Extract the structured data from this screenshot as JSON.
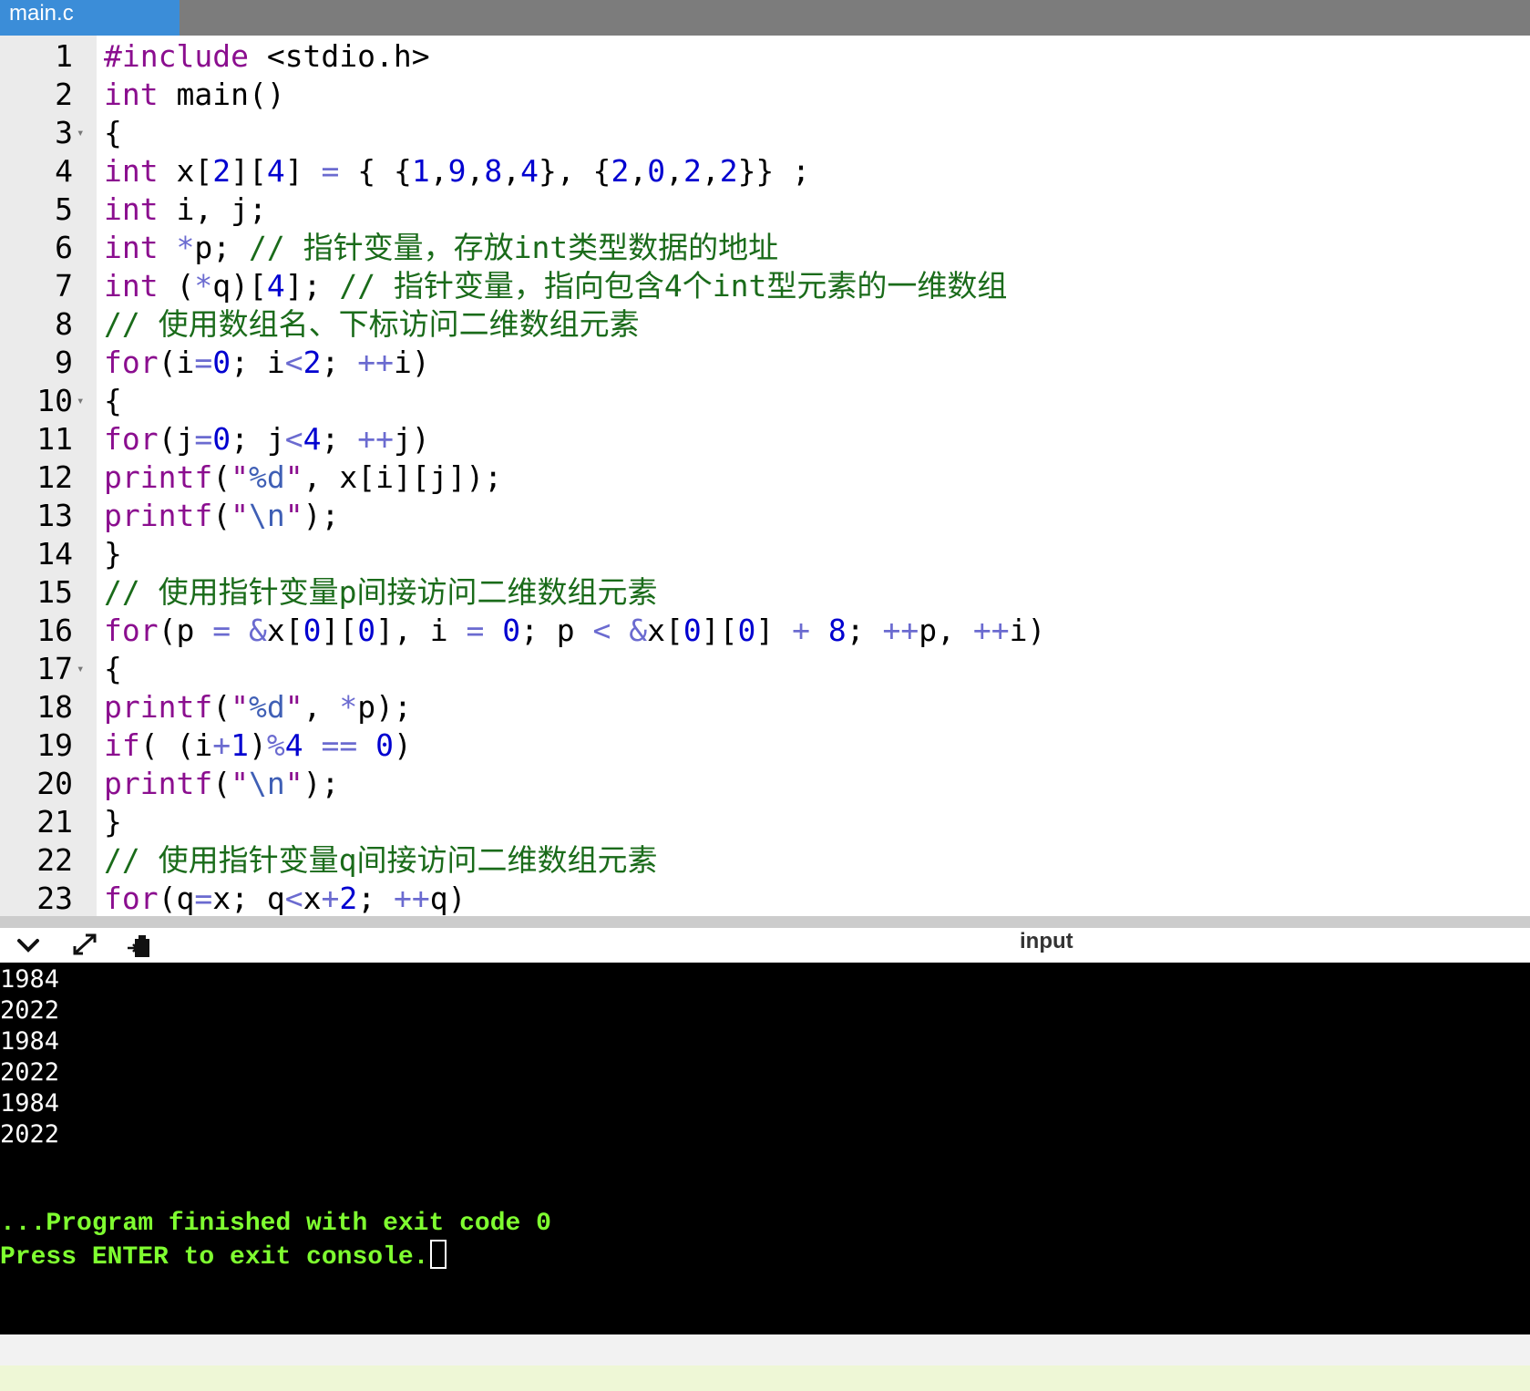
{
  "tab": {
    "filename": "main.c"
  },
  "editor": {
    "lines": [
      {
        "n": "1",
        "fold": "",
        "tokens": [
          [
            "pp",
            "#include"
          ],
          [
            "txt",
            " <stdio.h>"
          ]
        ]
      },
      {
        "n": "2",
        "fold": "",
        "tokens": [
          [
            "kw",
            "int"
          ],
          [
            "txt",
            " main()"
          ]
        ]
      },
      {
        "n": "3",
        "fold": "▾",
        "tokens": [
          [
            "txt",
            "{"
          ]
        ]
      },
      {
        "n": "4",
        "fold": "",
        "tokens": [
          [
            "kw",
            "int"
          ],
          [
            "txt",
            " x["
          ],
          [
            "num",
            "2"
          ],
          [
            "txt",
            "]["
          ],
          [
            "num",
            "4"
          ],
          [
            "txt",
            "] "
          ],
          [
            "op",
            "="
          ],
          [
            "txt",
            " { {"
          ],
          [
            "num",
            "1"
          ],
          [
            "txt",
            ","
          ],
          [
            "num",
            "9"
          ],
          [
            "txt",
            ","
          ],
          [
            "num",
            "8"
          ],
          [
            "txt",
            ","
          ],
          [
            "num",
            "4"
          ],
          [
            "txt",
            "}, {"
          ],
          [
            "num",
            "2"
          ],
          [
            "txt",
            ","
          ],
          [
            "num",
            "0"
          ],
          [
            "txt",
            ","
          ],
          [
            "num",
            "2"
          ],
          [
            "txt",
            ","
          ],
          [
            "num",
            "2"
          ],
          [
            "txt",
            "}} ;"
          ]
        ]
      },
      {
        "n": "5",
        "fold": "",
        "tokens": [
          [
            "kw",
            "int"
          ],
          [
            "txt",
            " i, j;"
          ]
        ]
      },
      {
        "n": "6",
        "fold": "",
        "tokens": [
          [
            "kw",
            "int"
          ],
          [
            "txt",
            " "
          ],
          [
            "op",
            "*"
          ],
          [
            "txt",
            "p; "
          ],
          [
            "cm",
            "// 指针变量，存放int类型数据的地址"
          ]
        ]
      },
      {
        "n": "7",
        "fold": "",
        "tokens": [
          [
            "kw",
            "int"
          ],
          [
            "txt",
            " ("
          ],
          [
            "op",
            "*"
          ],
          [
            "txt",
            "q)["
          ],
          [
            "num",
            "4"
          ],
          [
            "txt",
            "]; "
          ],
          [
            "cm",
            "// 指针变量，指向包含4个int型元素的一维数组"
          ]
        ]
      },
      {
        "n": "8",
        "fold": "",
        "tokens": [
          [
            "cm",
            "// 使用数组名、下标访问二维数组元素"
          ]
        ]
      },
      {
        "n": "9",
        "fold": "",
        "tokens": [
          [
            "kw",
            "for"
          ],
          [
            "txt",
            "(i"
          ],
          [
            "op",
            "="
          ],
          [
            "num",
            "0"
          ],
          [
            "txt",
            "; i"
          ],
          [
            "op",
            "<"
          ],
          [
            "num",
            "2"
          ],
          [
            "txt",
            "; "
          ],
          [
            "op",
            "++"
          ],
          [
            "txt",
            "i)"
          ]
        ]
      },
      {
        "n": "10",
        "fold": "▾",
        "tokens": [
          [
            "txt",
            "{"
          ]
        ]
      },
      {
        "n": "11",
        "fold": "",
        "tokens": [
          [
            "kw",
            "for"
          ],
          [
            "txt",
            "(j"
          ],
          [
            "op",
            "="
          ],
          [
            "num",
            "0"
          ],
          [
            "txt",
            "; j"
          ],
          [
            "op",
            "<"
          ],
          [
            "num",
            "4"
          ],
          [
            "txt",
            "; "
          ],
          [
            "op",
            "++"
          ],
          [
            "txt",
            "j)"
          ]
        ]
      },
      {
        "n": "12",
        "fold": "",
        "tokens": [
          [
            "fn",
            "printf"
          ],
          [
            "txt",
            "("
          ],
          [
            "str",
            "\""
          ],
          [
            "esc",
            "%d"
          ],
          [
            "str",
            "\""
          ],
          [
            "txt",
            ", x[i][j]);"
          ]
        ]
      },
      {
        "n": "13",
        "fold": "",
        "tokens": [
          [
            "fn",
            "printf"
          ],
          [
            "txt",
            "("
          ],
          [
            "str",
            "\""
          ],
          [
            "esc",
            "\\n"
          ],
          [
            "str",
            "\""
          ],
          [
            "txt",
            ");"
          ]
        ]
      },
      {
        "n": "14",
        "fold": "",
        "tokens": [
          [
            "txt",
            "}"
          ]
        ]
      },
      {
        "n": "15",
        "fold": "",
        "tokens": [
          [
            "cm",
            "// 使用指针变量p间接访问二维数组元素"
          ]
        ]
      },
      {
        "n": "16",
        "fold": "",
        "tokens": [
          [
            "kw",
            "for"
          ],
          [
            "txt",
            "(p "
          ],
          [
            "op",
            "="
          ],
          [
            "txt",
            " "
          ],
          [
            "op",
            "&"
          ],
          [
            "txt",
            "x["
          ],
          [
            "num",
            "0"
          ],
          [
            "txt",
            "]["
          ],
          [
            "num",
            "0"
          ],
          [
            "txt",
            "], i "
          ],
          [
            "op",
            "="
          ],
          [
            "txt",
            " "
          ],
          [
            "num",
            "0"
          ],
          [
            "txt",
            "; p "
          ],
          [
            "op",
            "<"
          ],
          [
            "txt",
            " "
          ],
          [
            "op",
            "&"
          ],
          [
            "txt",
            "x["
          ],
          [
            "num",
            "0"
          ],
          [
            "txt",
            "]["
          ],
          [
            "num",
            "0"
          ],
          [
            "txt",
            "] "
          ],
          [
            "op",
            "+"
          ],
          [
            "txt",
            " "
          ],
          [
            "num",
            "8"
          ],
          [
            "txt",
            "; "
          ],
          [
            "op",
            "++"
          ],
          [
            "txt",
            "p, "
          ],
          [
            "op",
            "++"
          ],
          [
            "txt",
            "i)"
          ]
        ]
      },
      {
        "n": "17",
        "fold": "▾",
        "tokens": [
          [
            "txt",
            "{"
          ]
        ]
      },
      {
        "n": "18",
        "fold": "",
        "tokens": [
          [
            "fn",
            "printf"
          ],
          [
            "txt",
            "("
          ],
          [
            "str",
            "\""
          ],
          [
            "esc",
            "%d"
          ],
          [
            "str",
            "\""
          ],
          [
            "txt",
            ", "
          ],
          [
            "op",
            "*"
          ],
          [
            "txt",
            "p);"
          ]
        ]
      },
      {
        "n": "19",
        "fold": "",
        "tokens": [
          [
            "kw",
            "if"
          ],
          [
            "txt",
            "( (i"
          ],
          [
            "op",
            "+"
          ],
          [
            "num",
            "1"
          ],
          [
            "txt",
            ")"
          ],
          [
            "op",
            "%"
          ],
          [
            "num",
            "4"
          ],
          [
            "txt",
            " "
          ],
          [
            "op",
            "=="
          ],
          [
            "txt",
            " "
          ],
          [
            "num",
            "0"
          ],
          [
            "txt",
            ")"
          ]
        ]
      },
      {
        "n": "20",
        "fold": "",
        "tokens": [
          [
            "fn",
            "printf"
          ],
          [
            "txt",
            "("
          ],
          [
            "str",
            "\""
          ],
          [
            "esc",
            "\\n"
          ],
          [
            "str",
            "\""
          ],
          [
            "txt",
            ");"
          ]
        ]
      },
      {
        "n": "21",
        "fold": "",
        "tokens": [
          [
            "txt",
            "}"
          ]
        ]
      },
      {
        "n": "22",
        "fold": "",
        "tokens": [
          [
            "cm",
            "// 使用指针变量q间接访问二维数组元素"
          ]
        ]
      },
      {
        "n": "23",
        "fold": "",
        "tokens": [
          [
            "kw",
            "for"
          ],
          [
            "txt",
            "(q"
          ],
          [
            "op",
            "="
          ],
          [
            "txt",
            "x; q"
          ],
          [
            "op",
            "<"
          ],
          [
            "txt",
            "x"
          ],
          [
            "op",
            "+"
          ],
          [
            "num",
            "2"
          ],
          [
            "txt",
            "; "
          ],
          [
            "op",
            "++"
          ],
          [
            "txt",
            "q)"
          ]
        ]
      }
    ]
  },
  "console": {
    "tab_label": "input",
    "icons": [
      "chevron-down-icon",
      "expand-icon",
      "copy-icon"
    ],
    "output": [
      "1984",
      "2022",
      "1984",
      "2022",
      "1984",
      "2022"
    ],
    "status_finished": "...Program finished with exit code 0",
    "status_prompt": "Press ENTER to exit console."
  },
  "colors": {
    "tab_active": "#3b8dd8",
    "keyword": "#8b0e8f",
    "number": "#0000d0",
    "comment": "#1a6b1a",
    "terminal_status": "#7fff30"
  }
}
